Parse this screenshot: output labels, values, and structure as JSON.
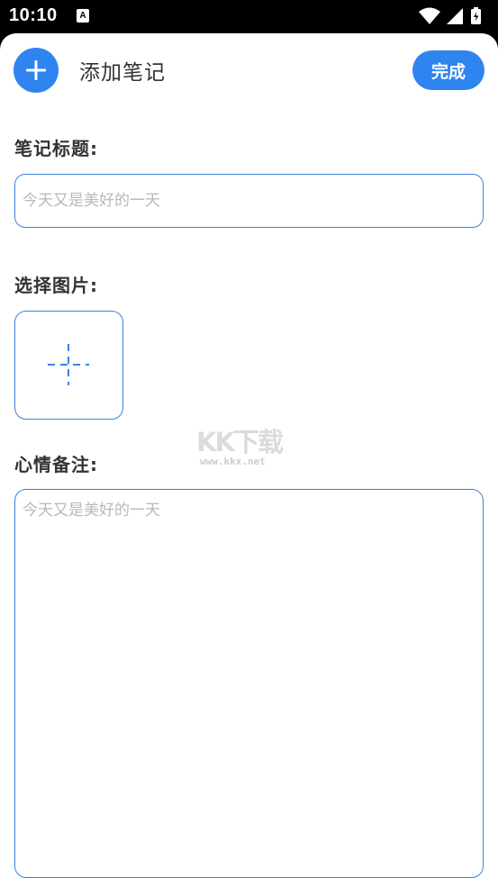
{
  "status_bar": {
    "time": "10:10",
    "notification_icon": "A",
    "icons": [
      "wifi-icon",
      "signal-icon",
      "battery-icon"
    ]
  },
  "header": {
    "add_icon": "plus-icon",
    "title": "添加笔记",
    "done_label": "完成"
  },
  "form": {
    "title_label": "笔记标题:",
    "title_placeholder": "今天又是美好的一天",
    "image_label": "选择图片:",
    "image_icon": "add-image-plus-icon",
    "mood_label": "心情备注:",
    "mood_placeholder": "今天又是美好的一天"
  },
  "watermark": {
    "logo": "KK下载",
    "url": "www.kkx.net"
  },
  "colors": {
    "accent": "#2f84f0",
    "border": "#3b82e0",
    "text": "#333333",
    "placeholder": "#b8b8b8"
  }
}
